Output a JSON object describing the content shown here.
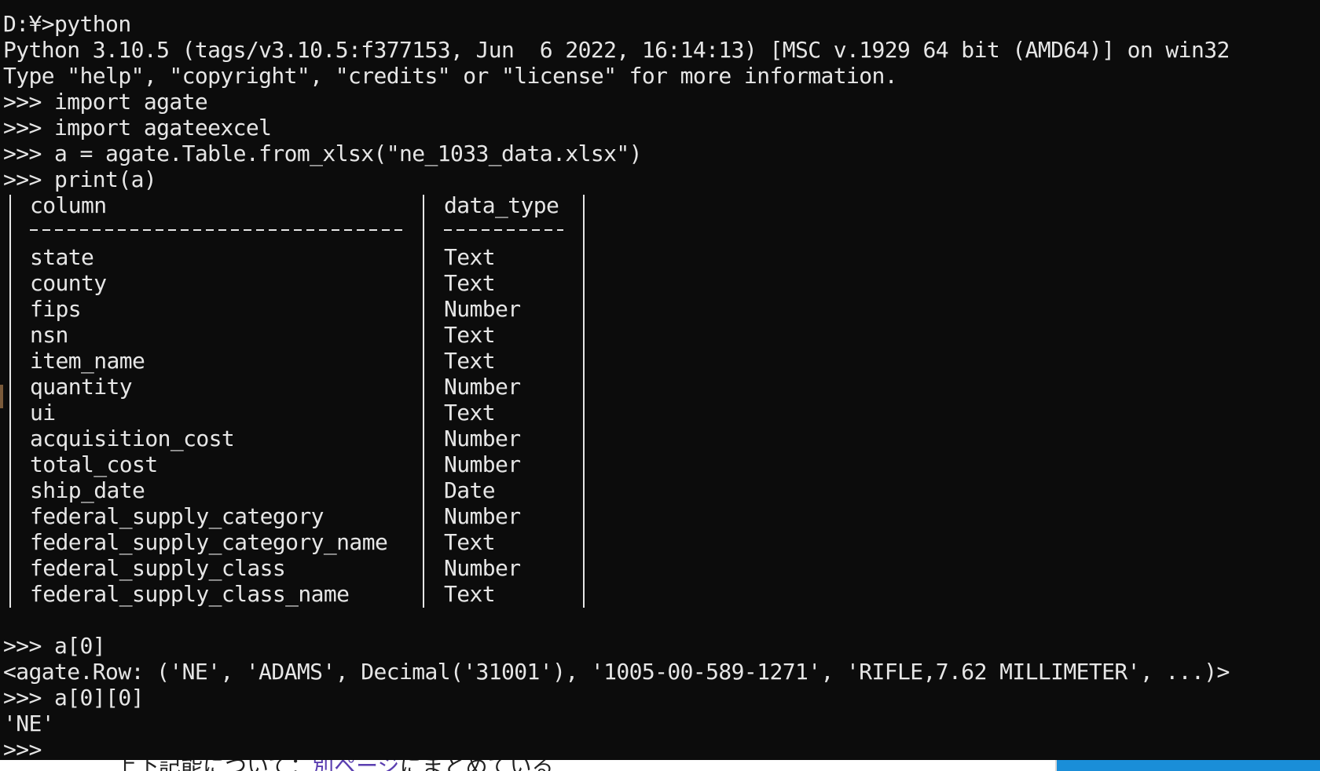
{
  "session": {
    "prompt_line": "D:¥>python",
    "banner_line1": "Python 3.10.5 (tags/v3.10.5:f377153, Jun  6 2022, 16:14:13) [MSC v.1929 64 bit (AMD64)] on win32",
    "banner_line2": "Type \"help\", \"copyright\", \"credits\" or \"license\" for more information.",
    "cmd_import_agate": ">>> import agate",
    "cmd_import_agateexcel": ">>> import agateexcel",
    "cmd_load": ">>> a = agate.Table.from_xlsx(\"ne_1033_data.xlsx\")",
    "cmd_print": ">>> print(a)",
    "cmd_a0": ">>> a[0]",
    "out_a0": "<agate.Row: ('NE', 'ADAMS', Decimal('31001'), '1005-00-589-1271', 'RIFLE,7.62 MILLIMETER', ...)>",
    "cmd_a00": ">>> a[0][0]",
    "out_a00": "'NE'",
    "final_prompt": ">>>"
  },
  "table": {
    "header_column": "column",
    "header_type": "data_type",
    "rows": [
      {
        "column": "state",
        "type": "Text"
      },
      {
        "column": "county",
        "type": "Text"
      },
      {
        "column": "fips",
        "type": "Number"
      },
      {
        "column": "nsn",
        "type": "Text"
      },
      {
        "column": "item_name",
        "type": "Text"
      },
      {
        "column": "quantity",
        "type": "Number"
      },
      {
        "column": "ui",
        "type": "Text"
      },
      {
        "column": "acquisition_cost",
        "type": "Number"
      },
      {
        "column": "total_cost",
        "type": "Number"
      },
      {
        "column": "ship_date",
        "type": "Date"
      },
      {
        "column": "federal_supply_category",
        "type": "Number"
      },
      {
        "column": "federal_supply_category_name",
        "type": "Text"
      },
      {
        "column": "federal_supply_class",
        "type": "Number"
      },
      {
        "column": "federal_supply_class_name",
        "type": "Text"
      }
    ]
  },
  "background_page": {
    "text_before": "上下記能について：",
    "link_text": "別ページ",
    "text_after": "にまとめている"
  },
  "colors": {
    "terminal_bg": "#0c0c0c",
    "terminal_fg": "#e6e6e6",
    "accent": "#1a8ed8"
  }
}
